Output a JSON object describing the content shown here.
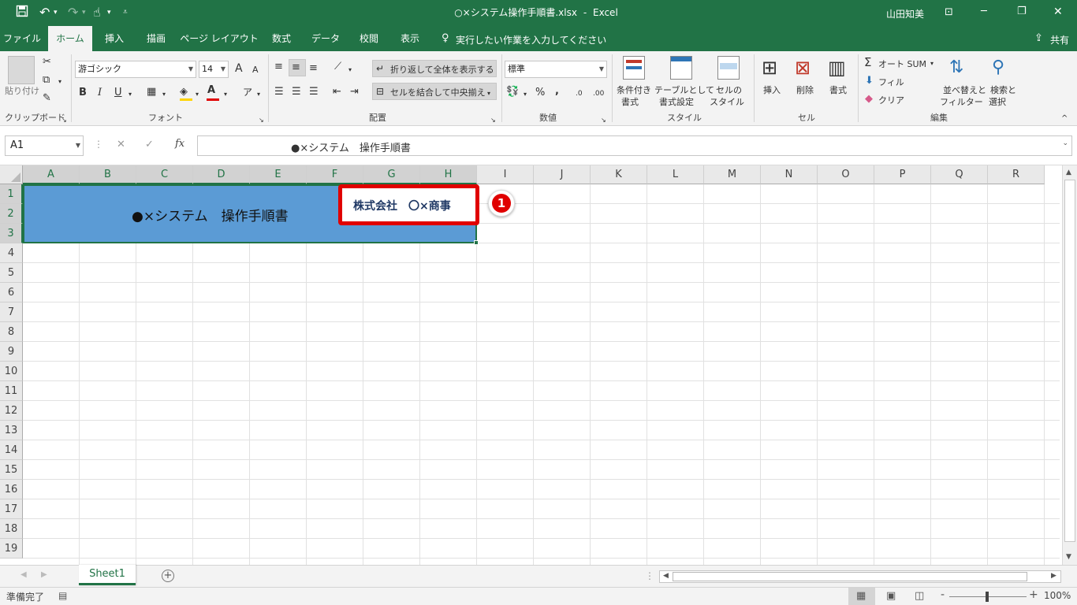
{
  "titlebar": {
    "filename": "○×システム操作手順書.xlsx",
    "separator": "-",
    "app": "Excel",
    "user": "山田知美",
    "minimize": "─",
    "restore": "❐",
    "close": "✕"
  },
  "tabs": [
    {
      "label": "ファイル"
    },
    {
      "label": "ホーム"
    },
    {
      "label": "挿入"
    },
    {
      "label": "描画"
    },
    {
      "label": "ページ レイアウト"
    },
    {
      "label": "数式"
    },
    {
      "label": "データ"
    },
    {
      "label": "校閲"
    },
    {
      "label": "表示"
    }
  ],
  "tellme": "実行したい作業を入力してください",
  "share": "共有",
  "ribbon": {
    "clipboard": {
      "paste": "貼り付け",
      "label": "クリップボード"
    },
    "font": {
      "name": "游ゴシック",
      "size": "14",
      "bold": "B",
      "italic": "I",
      "underline": "U",
      "grow": "A",
      "shrink": "A",
      "label": "フォント"
    },
    "alignment": {
      "wrap": "折り返して全体を表示する",
      "merge": "セルを結合して中央揃え",
      "label": "配置"
    },
    "number": {
      "format": "標準",
      "percent": "%",
      "comma": ",",
      "inc": ".0",
      "dec": ".00",
      "label": "数値"
    },
    "styles": {
      "cond1": "条件付き",
      "cond2": "書式",
      "table1": "テーブルとして",
      "table2": "書式設定",
      "cell1": "セルの",
      "cell2": "スタイル",
      "label": "スタイル"
    },
    "cells": {
      "insert": "挿入",
      "delete": "削除",
      "format": "書式",
      "label": "セル"
    },
    "editing": {
      "autosum": "オート SUM",
      "fill": "フィル",
      "clear": "クリア",
      "sort1": "並べ替えと",
      "sort2": "フィルター",
      "find1": "検索と",
      "find2": "選択",
      "label": "編集"
    }
  },
  "formula": {
    "namebox": "A1",
    "fx": "fx",
    "content": "●×システム　操作手順書"
  },
  "columns": [
    "A",
    "B",
    "C",
    "D",
    "E",
    "F",
    "G",
    "H",
    "I",
    "J",
    "K",
    "L",
    "M",
    "N",
    "O",
    "P",
    "Q",
    "R"
  ],
  "rows": [
    "1",
    "2",
    "3",
    "4",
    "5",
    "6",
    "7",
    "8",
    "9",
    "10",
    "11",
    "12",
    "13",
    "14",
    "15",
    "16",
    "17",
    "18",
    "19"
  ],
  "cells": {
    "merged_title": "●×システム　操作手順書",
    "company": "株式会社　〇×商事",
    "marker": "1"
  },
  "colors": {
    "excel_green": "#217346",
    "title_fill": "#5b9bd5",
    "callout_red": "#e00000"
  },
  "sheet": {
    "tab": "Sheet1",
    "add": "+"
  },
  "status": {
    "ready": "準備完了",
    "zoom": "100%",
    "minus": "-",
    "plus": "+"
  }
}
